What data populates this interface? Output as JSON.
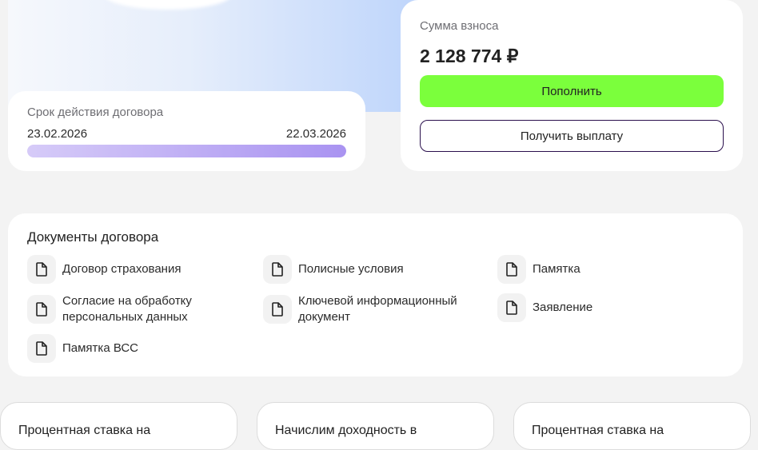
{
  "term": {
    "label": "Срок действия договора",
    "start_date": "23.02.2026",
    "end_date": "22.03.2026",
    "progress": 1.0
  },
  "contribution": {
    "label": "Сумма взноса",
    "amount": "2 128 774 ₽",
    "topup_button": "Пополнить",
    "payout_button": "Получить выплату"
  },
  "documents": {
    "title": "Документы договора",
    "items": [
      {
        "label": "Договор страхования",
        "icon": "document-icon"
      },
      {
        "label": "Полисные условия",
        "icon": "document-icon"
      },
      {
        "label": "Памятка",
        "icon": "document-icon"
      },
      {
        "label_line1": "Согласие на обработку",
        "label_line2": "персональных данных",
        "icon": "document-icon"
      },
      {
        "label_line1": "Ключевой информационный",
        "label_line2": "документ",
        "icon": "document-icon"
      },
      {
        "label": "Заявление",
        "icon": "document-icon"
      },
      {
        "label": "Памятка ВСС",
        "icon": "document-icon"
      }
    ]
  },
  "promo_cards": [
    {
      "title": "Процентная ставка на"
    },
    {
      "title": "Начислим доходность в"
    },
    {
      "title": "Процентная ставка на"
    }
  ],
  "colors": {
    "accent_green": "#7bff3c",
    "outline_purple": "#2a0f4d",
    "progress_purple": "#a993f1"
  }
}
